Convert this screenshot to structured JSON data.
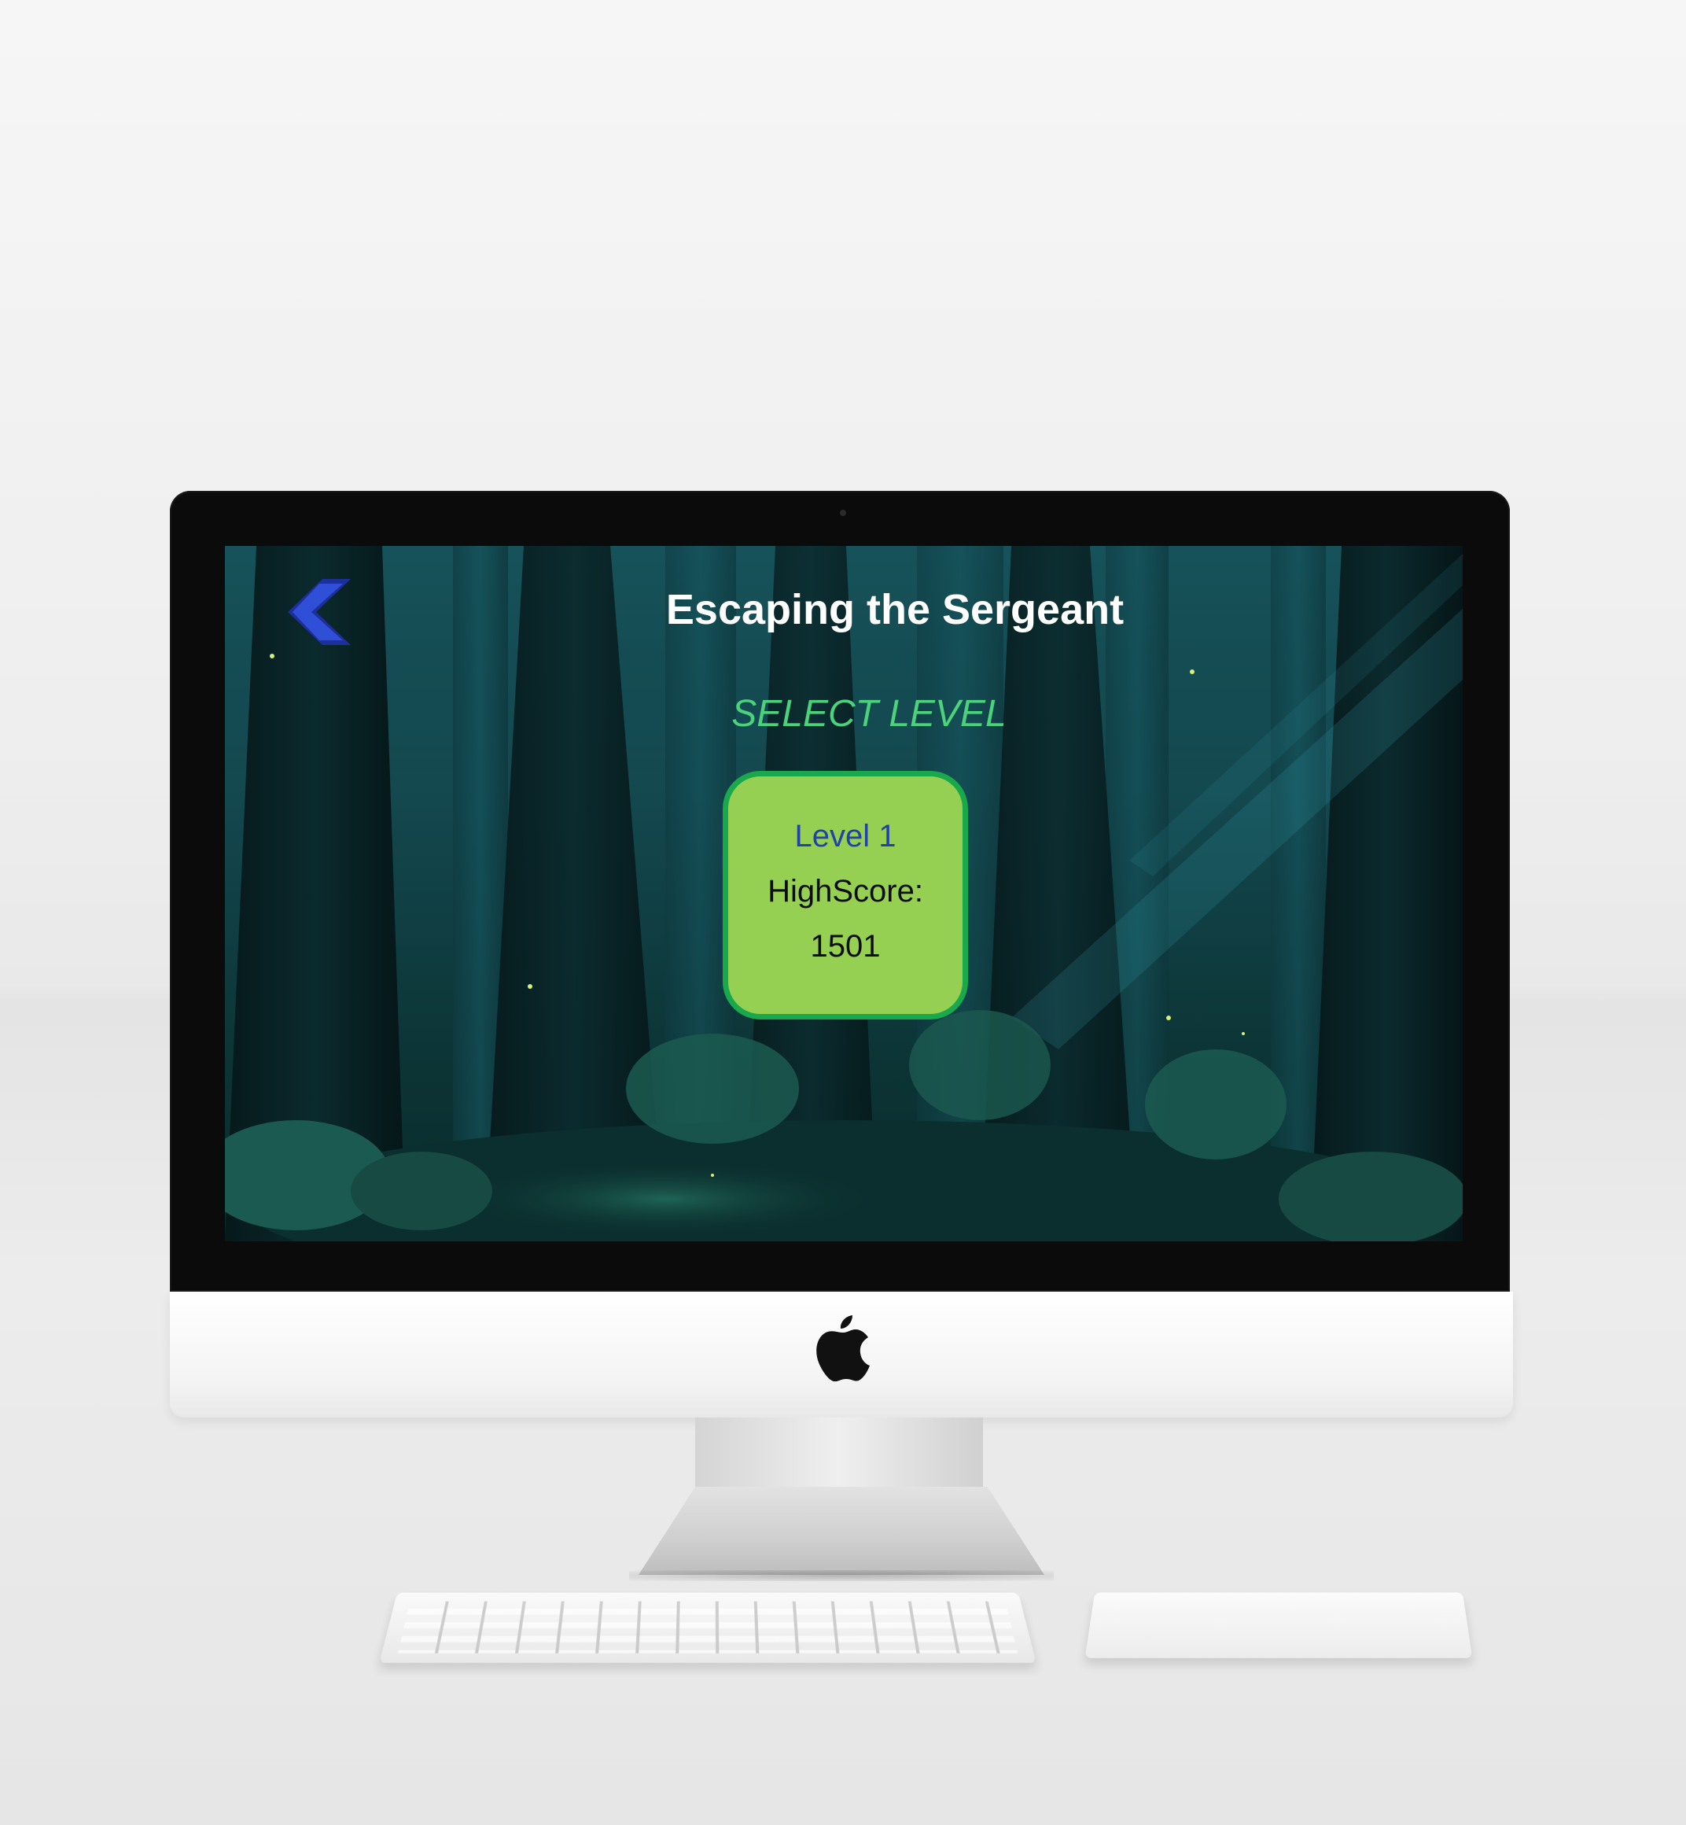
{
  "game": {
    "title": "Escaping the Sergeant",
    "select_heading": "SELECT LEVEL",
    "back_icon": "chevron-left-icon"
  },
  "levels": [
    {
      "name": "Level 1",
      "highscore_label": "HighScore:",
      "highscore_value": "1501"
    }
  ],
  "colors": {
    "title": "#ffffff",
    "select_heading": "#4cd27a",
    "card_fill": "#95d053",
    "card_border": "#19a84c",
    "level_name": "#2142a8",
    "back_icon": "#2a45c4"
  }
}
